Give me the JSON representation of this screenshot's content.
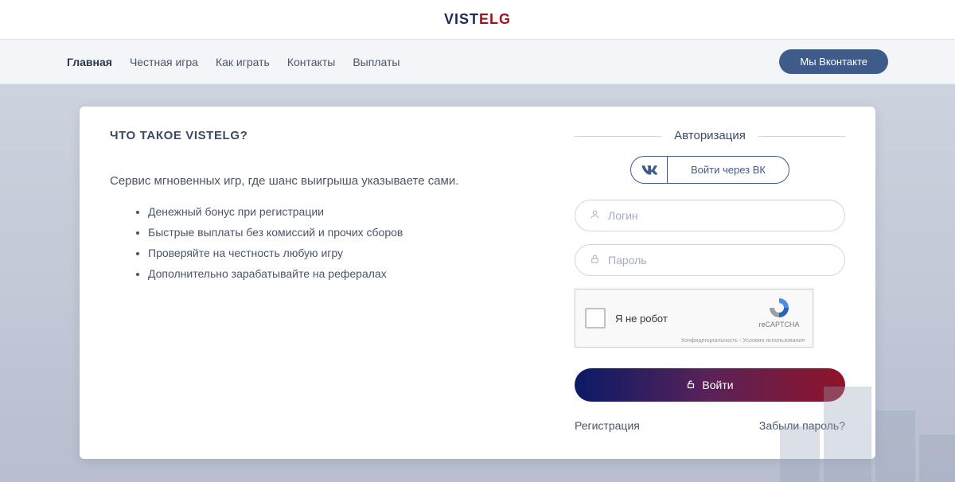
{
  "brand": {
    "part1": "VIST",
    "part2": "ELG"
  },
  "nav": {
    "items": [
      {
        "label": "Главная",
        "active": true
      },
      {
        "label": "Честная игра",
        "active": false
      },
      {
        "label": "Как играть",
        "active": false
      },
      {
        "label": "Контакты",
        "active": false
      },
      {
        "label": "Выплаты",
        "active": false
      }
    ],
    "vk_button": "Мы Вконтакте"
  },
  "main": {
    "heading": "ЧТО ТАКОЕ VISTELG?",
    "subhead": "Сервис мгновенных игр, где шанс выигрыша указываете сами.",
    "bullets": [
      "Денежный бонус при регистрации",
      "Быстрые выплаты без комиссий и прочих сборов",
      "Проверяйте на честность любую игру",
      "Дополнительно зарабатывайте на рефералах"
    ]
  },
  "auth": {
    "legend": "Авторизация",
    "vk_login": "Войти через ВК",
    "login_placeholder": "Логин",
    "password_placeholder": "Пароль",
    "recaptcha": {
      "text": "Я не робот",
      "brand": "reCAPTCHA",
      "terms": "Конфиденциальность - Условия использования"
    },
    "login_button": "Войти",
    "register_link": "Регистрация",
    "forgot_link": "Забыли пароль?"
  }
}
